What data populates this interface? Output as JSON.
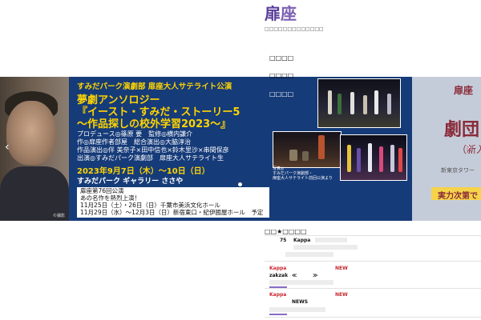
{
  "header": {
    "logo_glyph_1": "扉",
    "logo_glyph_2": "座",
    "tagline": "□□□□□□□□□□□□□",
    "colors": {
      "logo": "#5a3d9a"
    }
  },
  "nav": {
    "items": [
      {
        "label": "□□□□"
      },
      {
        "label": "□□□□"
      },
      {
        "label": "□□□□"
      }
    ]
  },
  "slider": {
    "arrows": {
      "left": "‹",
      "right": "›"
    },
    "photo_credit": "©撮影",
    "title_small": "すみだパーク演劇部 扉座大人サテライト公演",
    "title_line1": "夢劇アンソロジー",
    "title_line2": "『イースト・すみだ・ストーリー5",
    "title_line3": "～作品探しの校外学習2023～』",
    "credits": [
      "プロデュース◎篠原 要　監修◎横内謙介",
      "作◎扉座作者部屋　総合演出◎大脇淳治",
      "作品演出◎伴 美奈子×田中信也×鈴木里沙×串間保彦",
      "出演◎すみだパーク演劇部　扉座大人サテライト生"
    ],
    "date": "2023年9月7日（木）～10日（日）",
    "venue": "すみだパーク ギャラリー ささや",
    "infobox": [
      "扉座第76回公演",
      "あの名作を熱烈上演！",
      "11月25日（土）・26日（日）千葉市美浜文化ホール",
      "11月29日（水）～12月3日（日）新宿東口・紀伊國屋ホール　予定"
    ],
    "photo_caption": [
      "写真◎",
      "すみだパーク演劇部・",
      "扉座大人サテライト前回公演より"
    ],
    "right_panel": {
      "line1": "扉座",
      "line2": "劇団",
      "line3": "（新入",
      "line4": "新東京タワー",
      "line5": "実力次第で"
    },
    "pagination_dots": 3,
    "colors": {
      "background": "#163b79",
      "accent": "#ffd400"
    }
  },
  "news": {
    "heading": "□□★□□□□",
    "rows": [
      {
        "num": "75",
        "title": "Kappa"
      },
      {
        "tag": "Kappa",
        "badge": "NEW",
        "source": "zakzak",
        "prev": "≪",
        "next": "≫"
      },
      {
        "tag": "Kappa",
        "badge": "NEW",
        "label": "NEWS"
      }
    ],
    "colors": {
      "tag": "#c8262e",
      "accent": "#8a6bc7"
    }
  }
}
